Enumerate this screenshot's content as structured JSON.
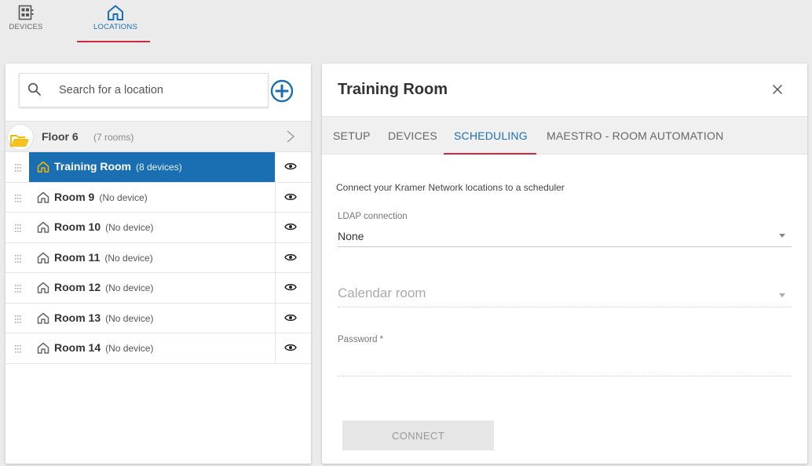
{
  "topnav": {
    "devices_label": "DEVICES",
    "locations_label": "LOCATIONS",
    "active": "LOCATIONS"
  },
  "search": {
    "placeholder": "Search for a location"
  },
  "floor": {
    "name": "Floor 6",
    "count": "(7 rooms)"
  },
  "rooms": [
    {
      "name": "Training Room",
      "info": "(8 devices)",
      "selected": true
    },
    {
      "name": "Room 9",
      "info": "(No device)",
      "selected": false
    },
    {
      "name": "Room 10",
      "info": "(No device)",
      "selected": false
    },
    {
      "name": "Room 11",
      "info": "(No device)",
      "selected": false
    },
    {
      "name": "Room 12",
      "info": "(No device)",
      "selected": false
    },
    {
      "name": "Room 13",
      "info": "(No device)",
      "selected": false
    },
    {
      "name": "Room 14",
      "info": "(No device)",
      "selected": false
    }
  ],
  "detail": {
    "title": "Training Room",
    "tabs": [
      {
        "label": "SETUP"
      },
      {
        "label": "DEVICES"
      },
      {
        "label": "SCHEDULING"
      },
      {
        "label": "MAESTRO - ROOM AUTOMATION"
      }
    ],
    "active_tab": "SCHEDULING",
    "description": "Connect your Kramer Network locations to a scheduler",
    "ldap_label": "LDAP connection",
    "ldap_value": "None",
    "calendar_placeholder": "Calendar room",
    "password_label": "Password *",
    "password_value": "",
    "connect_label": "CONNECT"
  },
  "colors": {
    "accent_blue": "#1a6fb3",
    "accent_red": "#d0283c",
    "panel_bg": "#ffffff",
    "page_bg": "#ebebeb",
    "folder_yellow": "#f5b800"
  },
  "icons": {
    "devices": "devices-icon",
    "locations": "house-icon",
    "search": "search-icon",
    "add": "plus-circle-icon",
    "folder": "folder-open-icon",
    "chevron": "chevron-right-icon",
    "grip": "drag-handle-icon",
    "eye": "eye-icon",
    "close": "close-icon"
  }
}
